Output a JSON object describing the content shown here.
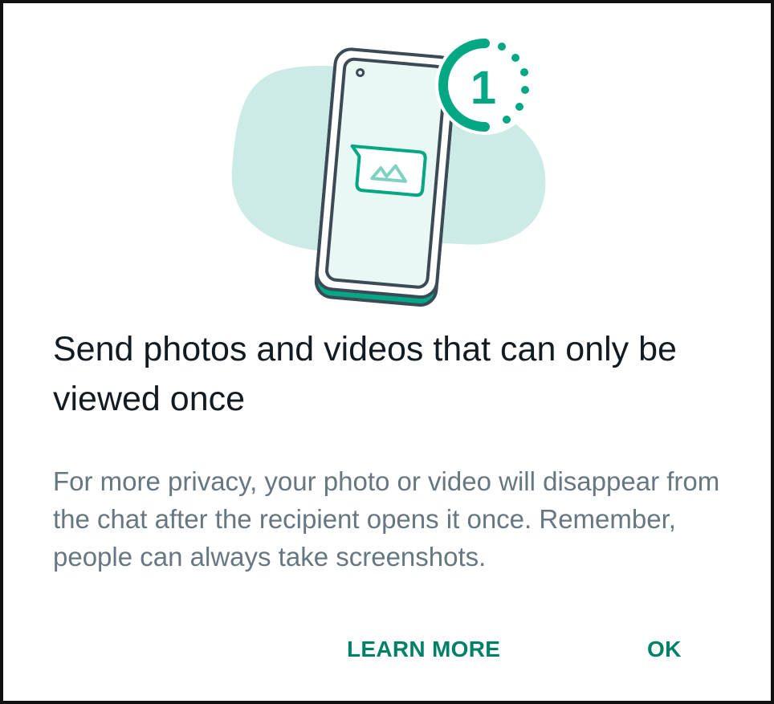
{
  "colors": {
    "accent": "#008069",
    "teal_illustration": "#02a884",
    "blob": "#cdebe6",
    "title": "#111b21",
    "body": "#667781",
    "phone_outline": "#3b4a54"
  },
  "illustration": {
    "timer_digit": "1"
  },
  "dialog": {
    "title": "Send photos and videos that can only be viewed once",
    "body": "For more privacy, your photo or video will disappear from the chat after the recipient opens it once. Remember, people can always take screenshots."
  },
  "actions": {
    "learn_more_label": "LEARN MORE",
    "ok_label": "OK"
  }
}
